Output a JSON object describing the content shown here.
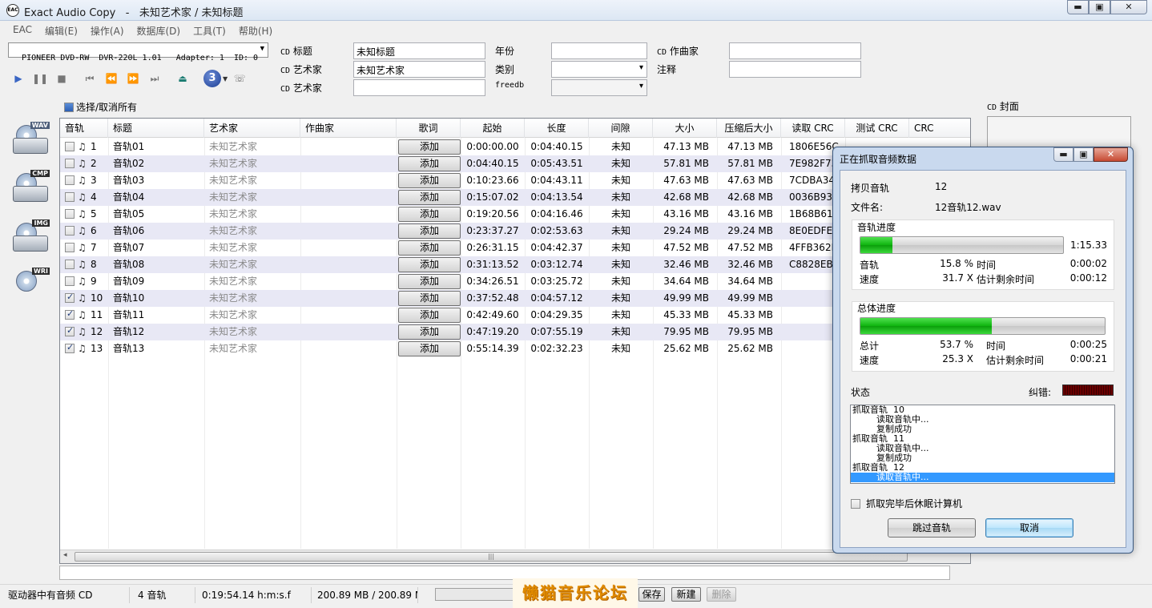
{
  "window": {
    "app_name": "Exact Audio Copy",
    "separator": "-",
    "doc_title": "未知艺术家 / 未知标题",
    "minimize": "▬",
    "maximize": "▣",
    "close": "✕"
  },
  "menu": [
    "EAC",
    "编辑(E)",
    "操作(A)",
    "数据库(D)",
    "工具(T)",
    "帮助(H)"
  ],
  "drive": {
    "value": "PIONEER DVD-RW  DVR-220L 1.01   Adapter: 1  ID: 0"
  },
  "toolbar": {
    "track_count_badge": "3"
  },
  "metadata": {
    "cd_prefix": "CD",
    "title_label": "标题",
    "title_value": "未知标题",
    "artist_label": "艺术家",
    "artist_value": "未知艺术家",
    "artist2_label": "艺术家",
    "artist2_value": "",
    "year_label": "年份",
    "year_value": "",
    "genre_label": "类别",
    "genre_value": "",
    "freedb_label": "freedb",
    "freedb_value": "",
    "composer_label": "作曲家",
    "composer_value": "",
    "comment_label": "注释",
    "comment_value": ""
  },
  "select_all_label": "选择/取消所有",
  "side_icons": [
    {
      "tag": "WAV",
      "name": "wav-icon"
    },
    {
      "tag": "CMP",
      "name": "cmp-icon"
    },
    {
      "tag": "IMG",
      "name": "img-icon"
    },
    {
      "tag": "WRI",
      "name": "wri-icon"
    }
  ],
  "columns": [
    "音轨",
    "标题",
    "艺术家",
    "作曲家",
    "歌词",
    "起始",
    "长度",
    "间隙",
    "大小",
    "压缩后大小",
    "读取 CRC",
    "测试 CRC",
    "CRC"
  ],
  "add_label": "添加",
  "tracks": [
    {
      "num": "1",
      "checked": false,
      "title": "音轨01",
      "artist": "未知艺术家",
      "start": "0:00:00.00",
      "length": "0:04:40.15",
      "gap": "未知",
      "size": "47.13 MB",
      "csize": "47.13 MB",
      "crc": "1806E56C"
    },
    {
      "num": "2",
      "checked": false,
      "title": "音轨02",
      "artist": "未知艺术家",
      "start": "0:04:40.15",
      "length": "0:05:43.51",
      "gap": "未知",
      "size": "57.81 MB",
      "csize": "57.81 MB",
      "crc": "7E982F73"
    },
    {
      "num": "3",
      "checked": false,
      "title": "音轨03",
      "artist": "未知艺术家",
      "start": "0:10:23.66",
      "length": "0:04:43.11",
      "gap": "未知",
      "size": "47.63 MB",
      "csize": "47.63 MB",
      "crc": "7CDBA34A"
    },
    {
      "num": "4",
      "checked": false,
      "title": "音轨04",
      "artist": "未知艺术家",
      "start": "0:15:07.02",
      "length": "0:04:13.54",
      "gap": "未知",
      "size": "42.68 MB",
      "csize": "42.68 MB",
      "crc": "0036B93B"
    },
    {
      "num": "5",
      "checked": false,
      "title": "音轨05",
      "artist": "未知艺术家",
      "start": "0:19:20.56",
      "length": "0:04:16.46",
      "gap": "未知",
      "size": "43.16 MB",
      "csize": "43.16 MB",
      "crc": "1B68B610"
    },
    {
      "num": "6",
      "checked": false,
      "title": "音轨06",
      "artist": "未知艺术家",
      "start": "0:23:37.27",
      "length": "0:02:53.63",
      "gap": "未知",
      "size": "29.24 MB",
      "csize": "29.24 MB",
      "crc": "8E0EDFED"
    },
    {
      "num": "7",
      "checked": false,
      "title": "音轨07",
      "artist": "未知艺术家",
      "start": "0:26:31.15",
      "length": "0:04:42.37",
      "gap": "未知",
      "size": "47.52 MB",
      "csize": "47.52 MB",
      "crc": "4FFB362F"
    },
    {
      "num": "8",
      "checked": false,
      "title": "音轨08",
      "artist": "未知艺术家",
      "start": "0:31:13.52",
      "length": "0:03:12.74",
      "gap": "未知",
      "size": "32.46 MB",
      "csize": "32.46 MB",
      "crc": "C8828EBF"
    },
    {
      "num": "9",
      "checked": false,
      "title": "音轨09",
      "artist": "未知艺术家",
      "start": "0:34:26.51",
      "length": "0:03:25.72",
      "gap": "未知",
      "size": "34.64 MB",
      "csize": "34.64 MB",
      "crc": ""
    },
    {
      "num": "10",
      "checked": true,
      "title": "音轨10",
      "artist": "未知艺术家",
      "start": "0:37:52.48",
      "length": "0:04:57.12",
      "gap": "未知",
      "size": "49.99 MB",
      "csize": "49.99 MB",
      "crc": ""
    },
    {
      "num": "11",
      "checked": true,
      "title": "音轨11",
      "artist": "未知艺术家",
      "start": "0:42:49.60",
      "length": "0:04:29.35",
      "gap": "未知",
      "size": "45.33 MB",
      "csize": "45.33 MB",
      "crc": ""
    },
    {
      "num": "12",
      "checked": true,
      "title": "音轨12",
      "artist": "未知艺术家",
      "start": "0:47:19.20",
      "length": "0:07:55.19",
      "gap": "未知",
      "size": "79.95 MB",
      "csize": "79.95 MB",
      "crc": ""
    },
    {
      "num": "13",
      "checked": true,
      "title": "音轨13",
      "artist": "未知艺术家",
      "start": "0:55:14.39",
      "length": "0:02:32.23",
      "gap": "未知",
      "size": "25.62 MB",
      "csize": "25.62 MB",
      "crc": ""
    }
  ],
  "cd_cover_label": "封面",
  "statusbar": {
    "drive_status": "驱动器中有音频 CD",
    "track_count": "4 音轨",
    "duration": "0:19:54.14 h:m:s.f",
    "size": "200.89 MB / 200.89 MB",
    "save": "保存",
    "new": "新建",
    "delete": "删除"
  },
  "watermark": "懒猫音乐论坛",
  "dialog": {
    "title": "正在抓取音频数据",
    "copy_track_label": "拷贝音轨",
    "copy_track_value": "12",
    "filename_label": "文件名:",
    "filename_value": "12音轨12.wav",
    "track_progress_label": "音轨进度",
    "track_progress": 0.158,
    "track_total_time": "1:15.33",
    "track_label": "音轨",
    "track_percent": "15.8 %",
    "time_label": "时间",
    "track_time": "0:00:02",
    "speed_label": "速度",
    "track_speed": "31.7 X",
    "remaining_label": "估计剩余时间",
    "track_remaining": "0:00:12",
    "total_progress_label": "总体进度",
    "total_progress": 0.537,
    "total_label": "总计",
    "total_percent": "53.7 %",
    "total_time": "0:00:25",
    "total_speed": "25.3 X",
    "total_remaining": "0:00:21",
    "status_label": "状态",
    "error_label": "纠错:",
    "log": [
      {
        "text": "抓取音轨  10",
        "indent": false,
        "selected": false
      },
      {
        "text": "读取音轨中...",
        "indent": true,
        "selected": false
      },
      {
        "text": "复制成功",
        "indent": true,
        "selected": false
      },
      {
        "text": "抓取音轨  11",
        "indent": false,
        "selected": false
      },
      {
        "text": "读取音轨中...",
        "indent": true,
        "selected": false
      },
      {
        "text": "复制成功",
        "indent": true,
        "selected": false
      },
      {
        "text": "抓取音轨  12",
        "indent": false,
        "selected": false
      },
      {
        "text": "读取音轨中...",
        "indent": true,
        "selected": true
      }
    ],
    "hibernate_label": "抓取完毕后休眠计算机",
    "skip_button": "跳过音轨",
    "cancel_button": "取消"
  }
}
